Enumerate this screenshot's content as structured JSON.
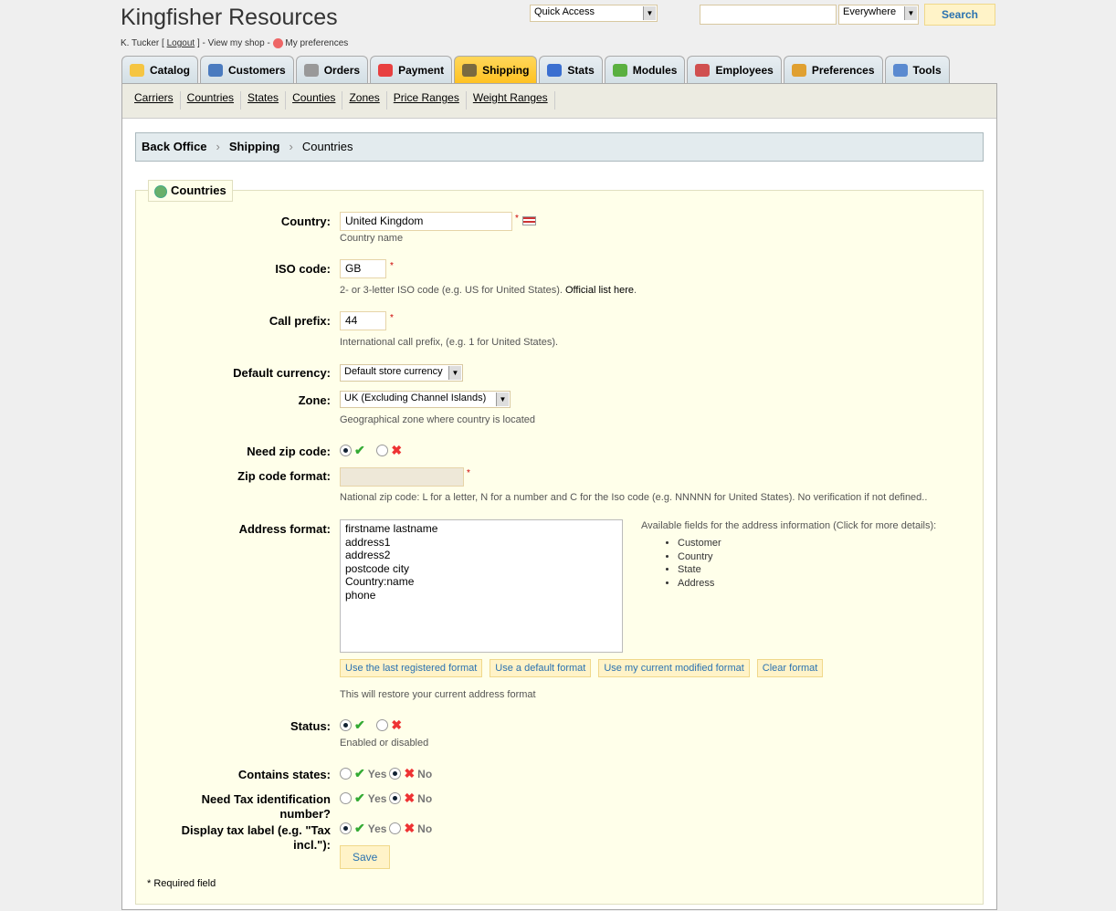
{
  "header": {
    "title": "Kingfisher Resources",
    "user": "K. Tucker [",
    "logout": "Logout",
    "user_rest": "] - View my shop -",
    "prefs": "My preferences",
    "quick_access": "Quick Access",
    "search_value": "",
    "search_scope": "Everywhere",
    "search_btn": "Search"
  },
  "tabs": [
    {
      "label": "Catalog",
      "color": "#f5c542"
    },
    {
      "label": "Customers",
      "color": "#4a7bbf"
    },
    {
      "label": "Orders",
      "color": "#999999"
    },
    {
      "label": "Payment",
      "color": "#e84040"
    },
    {
      "label": "Shipping",
      "color": "#7a6a40"
    },
    {
      "label": "Stats",
      "color": "#3a6fd0"
    },
    {
      "label": "Modules",
      "color": "#5ab040"
    },
    {
      "label": "Employees",
      "color": "#d05050"
    },
    {
      "label": "Preferences",
      "color": "#e0a030"
    },
    {
      "label": "Tools",
      "color": "#5a8ad0"
    }
  ],
  "subnav": [
    "Carriers",
    "Countries",
    "States",
    "Counties",
    "Zones",
    "Price Ranges",
    "Weight Ranges"
  ],
  "breadcrumb": [
    "Back Office",
    "Shipping",
    "Countries"
  ],
  "form": {
    "legend": "Countries",
    "country_label": "Country:",
    "country_value": "United Kingdom",
    "country_hint": "Country name",
    "iso_label": "ISO code:",
    "iso_value": "GB",
    "iso_hint": "2- or 3-letter ISO code (e.g. US for United States).",
    "iso_link": "Official list here",
    "prefix_label": "Call prefix:",
    "prefix_value": "44",
    "prefix_hint": "International call prefix, (e.g. 1 for United States).",
    "currency_label": "Default currency:",
    "currency_value": "Default store currency",
    "zone_label": "Zone:",
    "zone_value": "UK (Excluding Channel Islands)",
    "zone_hint": "Geographical zone where country is located",
    "zip_label": "Need zip code:",
    "zipfmt_label": "Zip code format:",
    "zipfmt_value": "",
    "zipfmt_hint": "National zip code: L for a letter, N for a number and C for the Iso code (e.g. NNNNN for United States). No verification if not defined..",
    "addr_label": "Address format:",
    "addr_value": "firstname lastname\naddress1\naddress2\npostcode city\nCountry:name\nphone",
    "fields_title": "Available fields for the address information (Click for more details):",
    "fields": [
      "Customer",
      "Country",
      "State",
      "Address"
    ],
    "buttons": [
      "Use the last registered format",
      "Use a default format",
      "Use my current modified format",
      "Clear format"
    ],
    "restore_hint": "This will restore your current address format",
    "status_label": "Status:",
    "status_hint": "Enabled or disabled",
    "states_label": "Contains states:",
    "tax_label": "Need Tax identification number?",
    "taxlbl_label": "Display tax label (e.g. \"Tax incl.\"):",
    "yes": "Yes",
    "no": "No",
    "save": "Save",
    "required": "* Required field"
  }
}
